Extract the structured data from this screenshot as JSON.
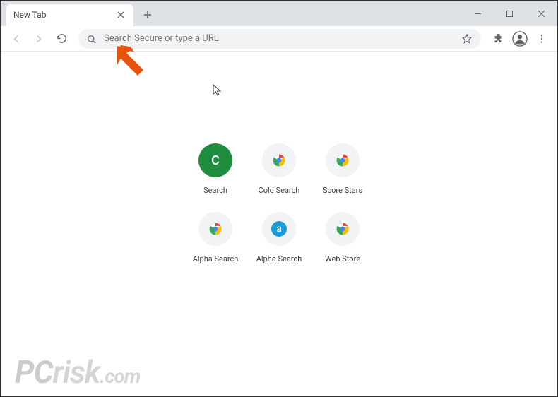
{
  "window": {
    "tab_title": "New Tab",
    "minimize": "–",
    "maximize": "□",
    "close": "×",
    "new_tab": "+"
  },
  "toolbar": {
    "omnibox_placeholder": "Search Secure or type a URL"
  },
  "shortcuts": [
    {
      "label": "Search",
      "type": "letter",
      "letter": "C"
    },
    {
      "label": "Cold Search",
      "type": "chrome"
    },
    {
      "label": "Score Stars",
      "type": "chrome"
    },
    {
      "label": "Alpha Search",
      "type": "chrome"
    },
    {
      "label": "Alpha Search",
      "type": "alpha",
      "letter": "a"
    },
    {
      "label": "Web Store",
      "type": "chrome"
    }
  ],
  "watermark": {
    "pc": "PC",
    "risk": "risk",
    "com": ".com"
  }
}
